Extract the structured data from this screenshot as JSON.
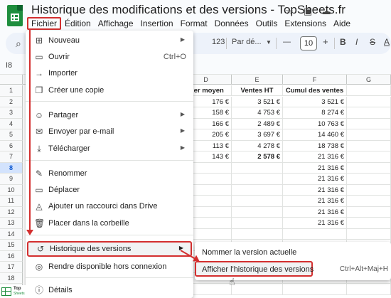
{
  "doc": {
    "title": "Historique des modifications et des versions - TopSheets.fr"
  },
  "menubar": [
    "Fichier",
    "Édition",
    "Affichage",
    "Insertion",
    "Format",
    "Données",
    "Outils",
    "Extensions",
    "Aide"
  ],
  "toolbar": {
    "zoom_format": "123",
    "font": "Par dé...",
    "font_size": "10",
    "minus": "—",
    "plus": "+"
  },
  "namebox": "I8",
  "columns": [
    "D",
    "E",
    "F",
    "G"
  ],
  "headers": {
    "d": "nier moyen",
    "e": "Ventes HT",
    "f": "Cumul des ventes"
  },
  "rows": [
    {
      "n": "1"
    },
    {
      "n": "2"
    },
    {
      "n": "3"
    },
    {
      "n": "4"
    },
    {
      "n": "5"
    },
    {
      "n": "6"
    },
    {
      "n": "7"
    },
    {
      "n": "8"
    },
    {
      "n": "9"
    },
    {
      "n": "10"
    },
    {
      "n": "11"
    },
    {
      "n": "12"
    },
    {
      "n": "13"
    },
    {
      "n": "14"
    },
    {
      "n": "15"
    },
    {
      "n": "16"
    },
    {
      "n": "17"
    },
    {
      "n": "18"
    },
    {
      "n": "19"
    }
  ],
  "cells": {
    "d": [
      "176 €",
      "158 €",
      "166 €",
      "205 €",
      "113 €",
      "143 €"
    ],
    "e": [
      "3 521 €",
      "4 753 €",
      "2 489 €",
      "3 697 €",
      "4 278 €",
      "2 578 €"
    ],
    "f": [
      "3 521 €",
      "8 274 €",
      "10 763 €",
      "14 460 €",
      "18 738 €",
      "21 316 €",
      "21 316 €",
      "21 316 €",
      "21 316 €",
      "21 316 €",
      "21 316 €",
      "21 316 €"
    ]
  },
  "menu": {
    "items": [
      {
        "label": "Nouveau",
        "icon": "grid-icon",
        "arrow": "▶"
      },
      {
        "label": "Ouvrir",
        "icon": "folder-icon",
        "shortcut": "Ctrl+O"
      },
      {
        "label": "Importer",
        "icon": "upload-icon"
      },
      {
        "label": "Créer une copie",
        "icon": "copy-icon"
      },
      {
        "label": "Partager",
        "icon": "person-add-icon",
        "arrow": "▶"
      },
      {
        "label": "Envoyer par e-mail",
        "icon": "mail-icon",
        "arrow": "▶"
      },
      {
        "label": "Télécharger",
        "icon": "download-icon",
        "arrow": "▶"
      },
      {
        "label": "Renommer",
        "icon": "rename-icon"
      },
      {
        "label": "Déplacer",
        "icon": "move-icon"
      },
      {
        "label": "Ajouter un raccourci dans Drive",
        "icon": "drive-shortcut-icon"
      },
      {
        "label": "Placer dans la corbeille",
        "icon": "trash-icon"
      },
      {
        "label": "Historique des versions",
        "icon": "history-icon",
        "arrow": "▶"
      },
      {
        "label": "Rendre disponible hors connexion",
        "icon": "offline-icon"
      },
      {
        "label": "Détails",
        "icon": "info-icon"
      }
    ]
  },
  "submenu": {
    "items": [
      {
        "label": "Nommer la version actuelle"
      },
      {
        "label": "Afficher l'historique des versions",
        "shortcut": "Ctrl+Alt+Maj+H"
      }
    ]
  },
  "watermark": {
    "line1": "Top",
    "line2": "Sheets"
  },
  "colors": {
    "accent_red": "#d32f2f",
    "sheets_green": "#1e8e3e"
  }
}
